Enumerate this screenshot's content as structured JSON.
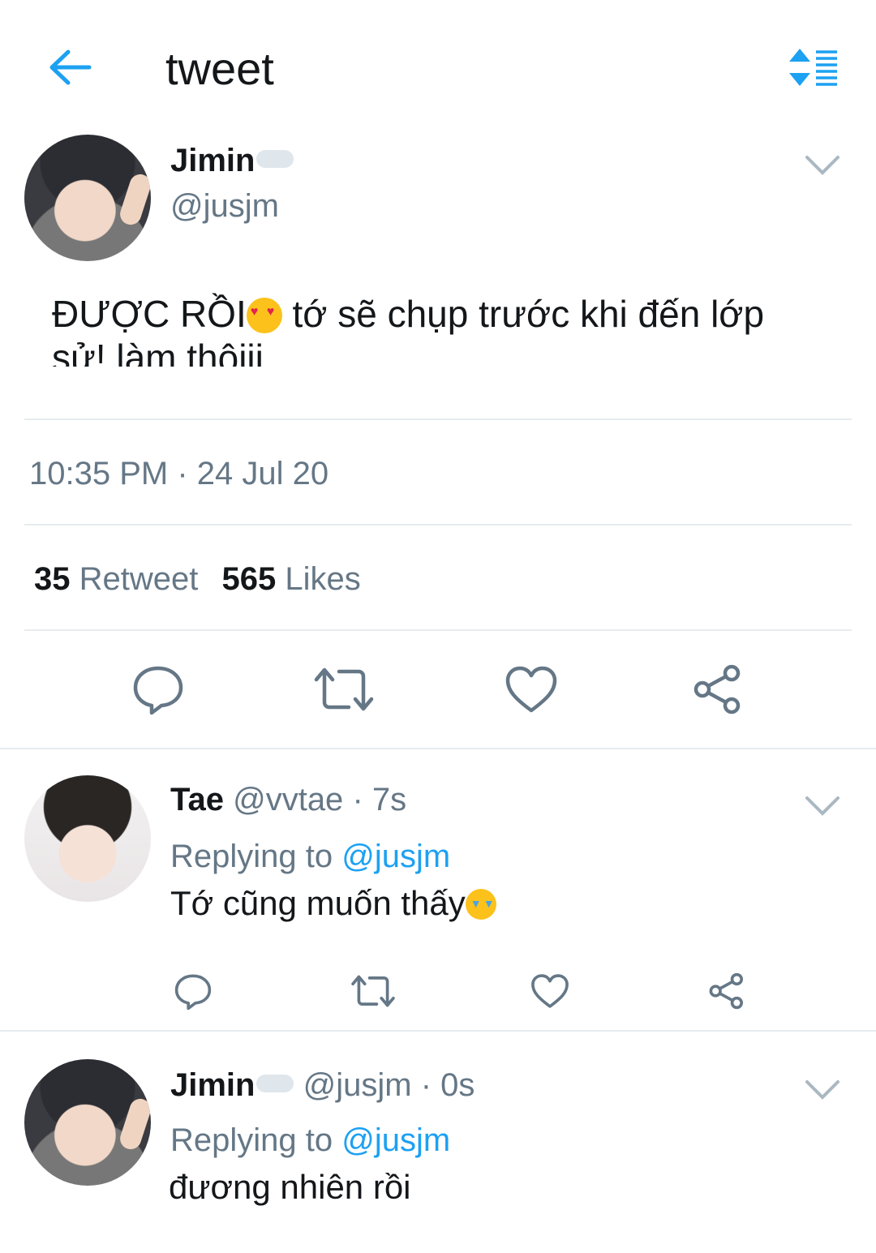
{
  "header": {
    "title": "tweet"
  },
  "main_tweet": {
    "display_name": "Jimin",
    "handle": "@jusjm",
    "text_before_emoji": "ĐƯỢC RỒI",
    "emoji": "heart-eyes-emoji",
    "text_after_emoji": " tớ sẽ chụp trước khi đến lớp",
    "text_line2": "sử! làm thôiii",
    "timestamp": "10:35 PM · 24 Jul 20",
    "retweet_count": "35",
    "retweet_label": "Retweet",
    "likes_count": "565",
    "likes_label": "Likes"
  },
  "replies": [
    {
      "display_name": "Tae",
      "handle": "@vvtae",
      "time": "· 7s",
      "replying_to_label": "Replying to",
      "replying_to_handle": "@jusjm",
      "text": "Tớ cũng muốn thấy",
      "emoji": "crying-emoji"
    },
    {
      "display_name": "Jimin",
      "handle": "@jusjm",
      "time": "· 0s",
      "replying_to_label": "Replying to",
      "replying_to_handle": "@jusjm",
      "text": "đương nhiên rồi"
    }
  ],
  "colors": {
    "accent": "#1da1f2",
    "secondary_text": "#657786",
    "icon": "#657786",
    "divider": "#e6ecf0"
  }
}
